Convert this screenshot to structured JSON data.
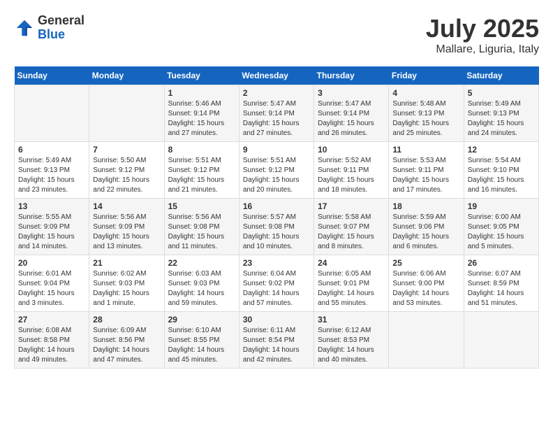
{
  "logo": {
    "general": "General",
    "blue": "Blue"
  },
  "title": {
    "month": "July 2025",
    "location": "Mallare, Liguria, Italy"
  },
  "headers": [
    "Sunday",
    "Monday",
    "Tuesday",
    "Wednesday",
    "Thursday",
    "Friday",
    "Saturday"
  ],
  "weeks": [
    [
      {
        "day": "",
        "info": ""
      },
      {
        "day": "",
        "info": ""
      },
      {
        "day": "1",
        "info": "Sunrise: 5:46 AM\nSunset: 9:14 PM\nDaylight: 15 hours\nand 27 minutes."
      },
      {
        "day": "2",
        "info": "Sunrise: 5:47 AM\nSunset: 9:14 PM\nDaylight: 15 hours\nand 27 minutes."
      },
      {
        "day": "3",
        "info": "Sunrise: 5:47 AM\nSunset: 9:14 PM\nDaylight: 15 hours\nand 26 minutes."
      },
      {
        "day": "4",
        "info": "Sunrise: 5:48 AM\nSunset: 9:13 PM\nDaylight: 15 hours\nand 25 minutes."
      },
      {
        "day": "5",
        "info": "Sunrise: 5:49 AM\nSunset: 9:13 PM\nDaylight: 15 hours\nand 24 minutes."
      }
    ],
    [
      {
        "day": "6",
        "info": "Sunrise: 5:49 AM\nSunset: 9:13 PM\nDaylight: 15 hours\nand 23 minutes."
      },
      {
        "day": "7",
        "info": "Sunrise: 5:50 AM\nSunset: 9:12 PM\nDaylight: 15 hours\nand 22 minutes."
      },
      {
        "day": "8",
        "info": "Sunrise: 5:51 AM\nSunset: 9:12 PM\nDaylight: 15 hours\nand 21 minutes."
      },
      {
        "day": "9",
        "info": "Sunrise: 5:51 AM\nSunset: 9:12 PM\nDaylight: 15 hours\nand 20 minutes."
      },
      {
        "day": "10",
        "info": "Sunrise: 5:52 AM\nSunset: 9:11 PM\nDaylight: 15 hours\nand 18 minutes."
      },
      {
        "day": "11",
        "info": "Sunrise: 5:53 AM\nSunset: 9:11 PM\nDaylight: 15 hours\nand 17 minutes."
      },
      {
        "day": "12",
        "info": "Sunrise: 5:54 AM\nSunset: 9:10 PM\nDaylight: 15 hours\nand 16 minutes."
      }
    ],
    [
      {
        "day": "13",
        "info": "Sunrise: 5:55 AM\nSunset: 9:09 PM\nDaylight: 15 hours\nand 14 minutes."
      },
      {
        "day": "14",
        "info": "Sunrise: 5:56 AM\nSunset: 9:09 PM\nDaylight: 15 hours\nand 13 minutes."
      },
      {
        "day": "15",
        "info": "Sunrise: 5:56 AM\nSunset: 9:08 PM\nDaylight: 15 hours\nand 11 minutes."
      },
      {
        "day": "16",
        "info": "Sunrise: 5:57 AM\nSunset: 9:08 PM\nDaylight: 15 hours\nand 10 minutes."
      },
      {
        "day": "17",
        "info": "Sunrise: 5:58 AM\nSunset: 9:07 PM\nDaylight: 15 hours\nand 8 minutes."
      },
      {
        "day": "18",
        "info": "Sunrise: 5:59 AM\nSunset: 9:06 PM\nDaylight: 15 hours\nand 6 minutes."
      },
      {
        "day": "19",
        "info": "Sunrise: 6:00 AM\nSunset: 9:05 PM\nDaylight: 15 hours\nand 5 minutes."
      }
    ],
    [
      {
        "day": "20",
        "info": "Sunrise: 6:01 AM\nSunset: 9:04 PM\nDaylight: 15 hours\nand 3 minutes."
      },
      {
        "day": "21",
        "info": "Sunrise: 6:02 AM\nSunset: 9:03 PM\nDaylight: 15 hours\nand 1 minute."
      },
      {
        "day": "22",
        "info": "Sunrise: 6:03 AM\nSunset: 9:03 PM\nDaylight: 14 hours\nand 59 minutes."
      },
      {
        "day": "23",
        "info": "Sunrise: 6:04 AM\nSunset: 9:02 PM\nDaylight: 14 hours\nand 57 minutes."
      },
      {
        "day": "24",
        "info": "Sunrise: 6:05 AM\nSunset: 9:01 PM\nDaylight: 14 hours\nand 55 minutes."
      },
      {
        "day": "25",
        "info": "Sunrise: 6:06 AM\nSunset: 9:00 PM\nDaylight: 14 hours\nand 53 minutes."
      },
      {
        "day": "26",
        "info": "Sunrise: 6:07 AM\nSunset: 8:59 PM\nDaylight: 14 hours\nand 51 minutes."
      }
    ],
    [
      {
        "day": "27",
        "info": "Sunrise: 6:08 AM\nSunset: 8:58 PM\nDaylight: 14 hours\nand 49 minutes."
      },
      {
        "day": "28",
        "info": "Sunrise: 6:09 AM\nSunset: 8:56 PM\nDaylight: 14 hours\nand 47 minutes."
      },
      {
        "day": "29",
        "info": "Sunrise: 6:10 AM\nSunset: 8:55 PM\nDaylight: 14 hours\nand 45 minutes."
      },
      {
        "day": "30",
        "info": "Sunrise: 6:11 AM\nSunset: 8:54 PM\nDaylight: 14 hours\nand 42 minutes."
      },
      {
        "day": "31",
        "info": "Sunrise: 6:12 AM\nSunset: 8:53 PM\nDaylight: 14 hours\nand 40 minutes."
      },
      {
        "day": "",
        "info": ""
      },
      {
        "day": "",
        "info": ""
      }
    ]
  ]
}
